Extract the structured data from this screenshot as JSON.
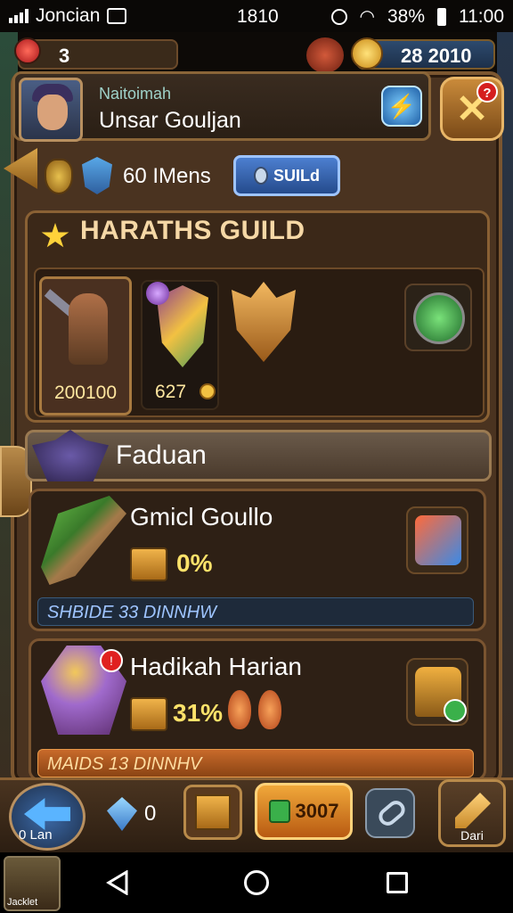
{
  "status_bar": {
    "carrier": "Joncian",
    "clock_center": "1810",
    "battery": "38%",
    "time": "11:00"
  },
  "resources": {
    "left_count": "3",
    "gold": "28 2010"
  },
  "profile": {
    "subtitle": "Naitoimah",
    "name": "Unsar Gouljan"
  },
  "members_row": {
    "members_label": "60 IMens",
    "build_button": "SUILd"
  },
  "guild": {
    "title": "HARATHS GUILD",
    "hero_card_value": "200100",
    "shield_card_value": "627"
  },
  "faction": {
    "title": "Faduan"
  },
  "list": [
    {
      "name": "Gmicl Goullo",
      "percent": "0%",
      "strip": "SHBIDE 33 DINNHW"
    },
    {
      "name": "Hadikah Harian",
      "percent": "31%",
      "strip": "MAIDS 13 DINNHV"
    }
  ],
  "bottom_bar": {
    "back_label": "0 Lan",
    "gem_count": "0",
    "gold_value": "3007",
    "pencil_label": "Dari"
  },
  "app_thumb_label": "Jacklet",
  "colors": {
    "frame": "#4a3320",
    "border_gold": "#8a6134",
    "accent_blue": "#4c7fd0",
    "accent_gold": "#f0a83a",
    "text_yellow": "#ffe26a"
  }
}
